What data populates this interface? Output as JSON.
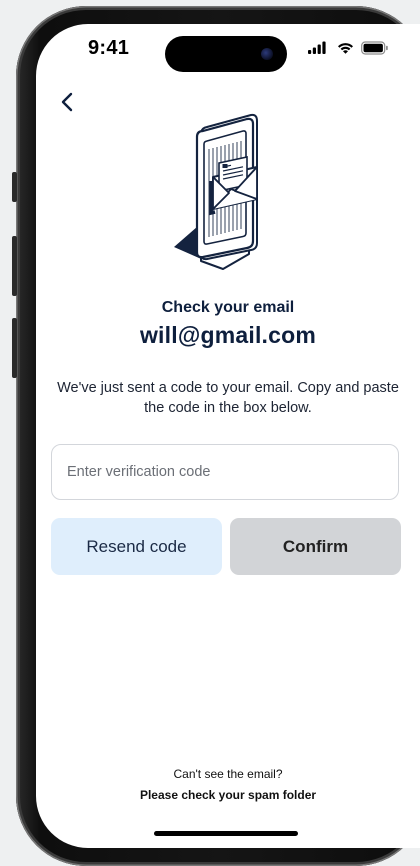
{
  "status_bar": {
    "time": "9:41"
  },
  "header": {
    "back_icon": "chevron-left-icon"
  },
  "content": {
    "illustration_icon": "phone-email-illustration",
    "title": "Check your email",
    "email": "will@gmail.com",
    "description": "We've just sent a code to your email. Copy and paste the code in the box below.",
    "code_input": {
      "value": "",
      "placeholder": "Enter verification code"
    },
    "resend_label": "Resend code",
    "confirm_label": "Confirm"
  },
  "footer": {
    "question": "Can't see the email?",
    "hint": "Please check your spam folder"
  },
  "colors": {
    "navy": "#0e1f3d",
    "resend_bg": "#dfeefc",
    "confirm_bg": "#d2d4d7"
  }
}
